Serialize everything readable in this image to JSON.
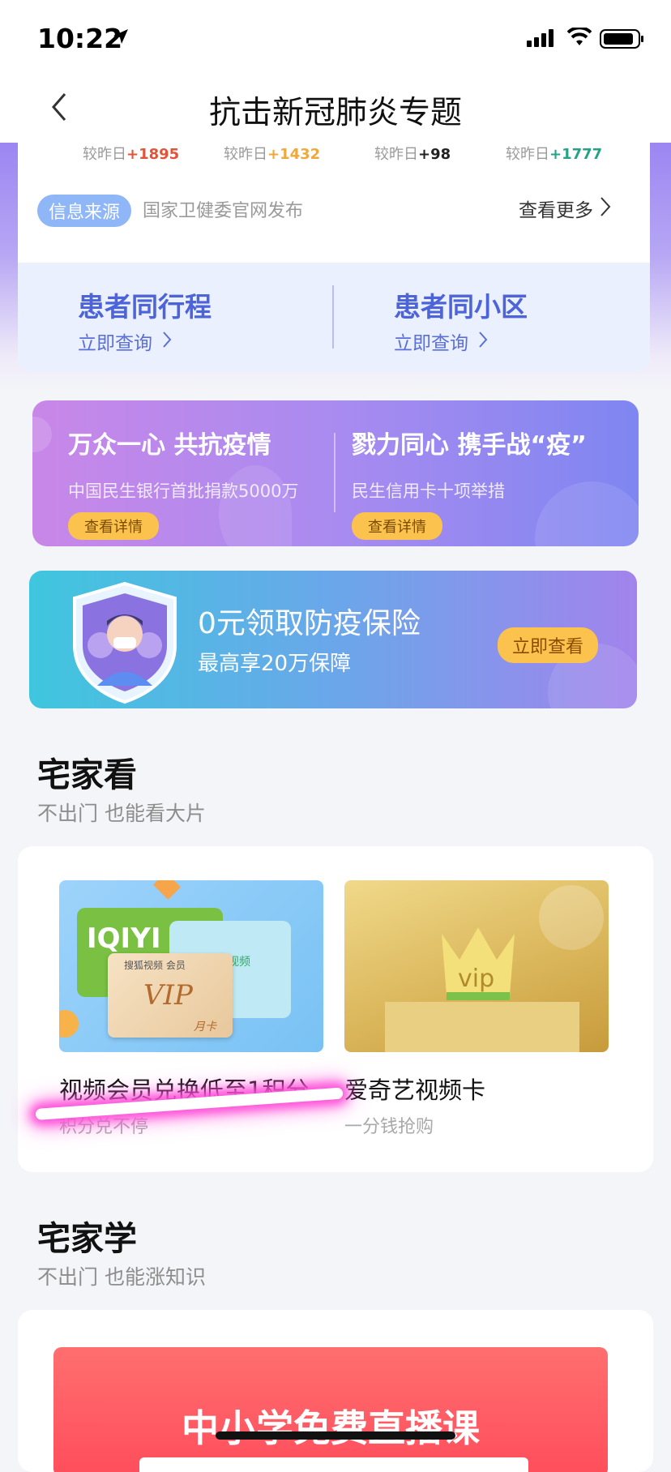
{
  "status_bar": {
    "time": "10:22"
  },
  "nav": {
    "title": "抗击新冠肺炎专题"
  },
  "stats": {
    "prefix": "较昨日",
    "deltas": [
      {
        "value": "+1895",
        "color": "#e0553a"
      },
      {
        "value": "+1432",
        "color": "#f0a73b"
      },
      {
        "value": "+98",
        "color": "#222222"
      },
      {
        "value": "+1777",
        "color": "#25a386"
      }
    ]
  },
  "source": {
    "badge": "信息来源",
    "text": "国家卫健委官网发布",
    "more": "查看更多"
  },
  "queries": [
    {
      "title": "患者同行程",
      "link": "立即查询"
    },
    {
      "title": "患者同小区",
      "link": "立即查询"
    }
  ],
  "banner1": [
    {
      "title": "万众一心 共抗疫情",
      "sub": "中国民生银行首批捐款5000万",
      "button": "查看详情"
    },
    {
      "title": "戮力同心 携手战“疫”",
      "sub": "民生信用卡十项举措",
      "button": "查看详情"
    }
  ],
  "banner2": {
    "title": "0元领取防疫保险",
    "sub": "最高享20万保障",
    "button": "立即查看"
  },
  "section_watch": {
    "title": "宅家看",
    "sub": "不出门 也能看大片"
  },
  "video_tiles": [
    {
      "title": "视频会员兑换低至1积分",
      "sub": "积分兑不停",
      "card_labels": [
        "IQIYI",
        "VIP",
        "月卡",
        "搜狐视频",
        "会员",
        "腾讯视频"
      ]
    },
    {
      "title": "爱奇艺视频卡",
      "sub": "一分钱抢购",
      "card_labels": [
        "vip"
      ]
    }
  ],
  "section_study": {
    "title": "宅家学",
    "sub": "不出门 也能涨知识"
  },
  "study_banner": {
    "title": "中小学免费直播课"
  },
  "colors": {
    "accent": "#4d63d9",
    "button_yellow": "#fbc24d"
  }
}
